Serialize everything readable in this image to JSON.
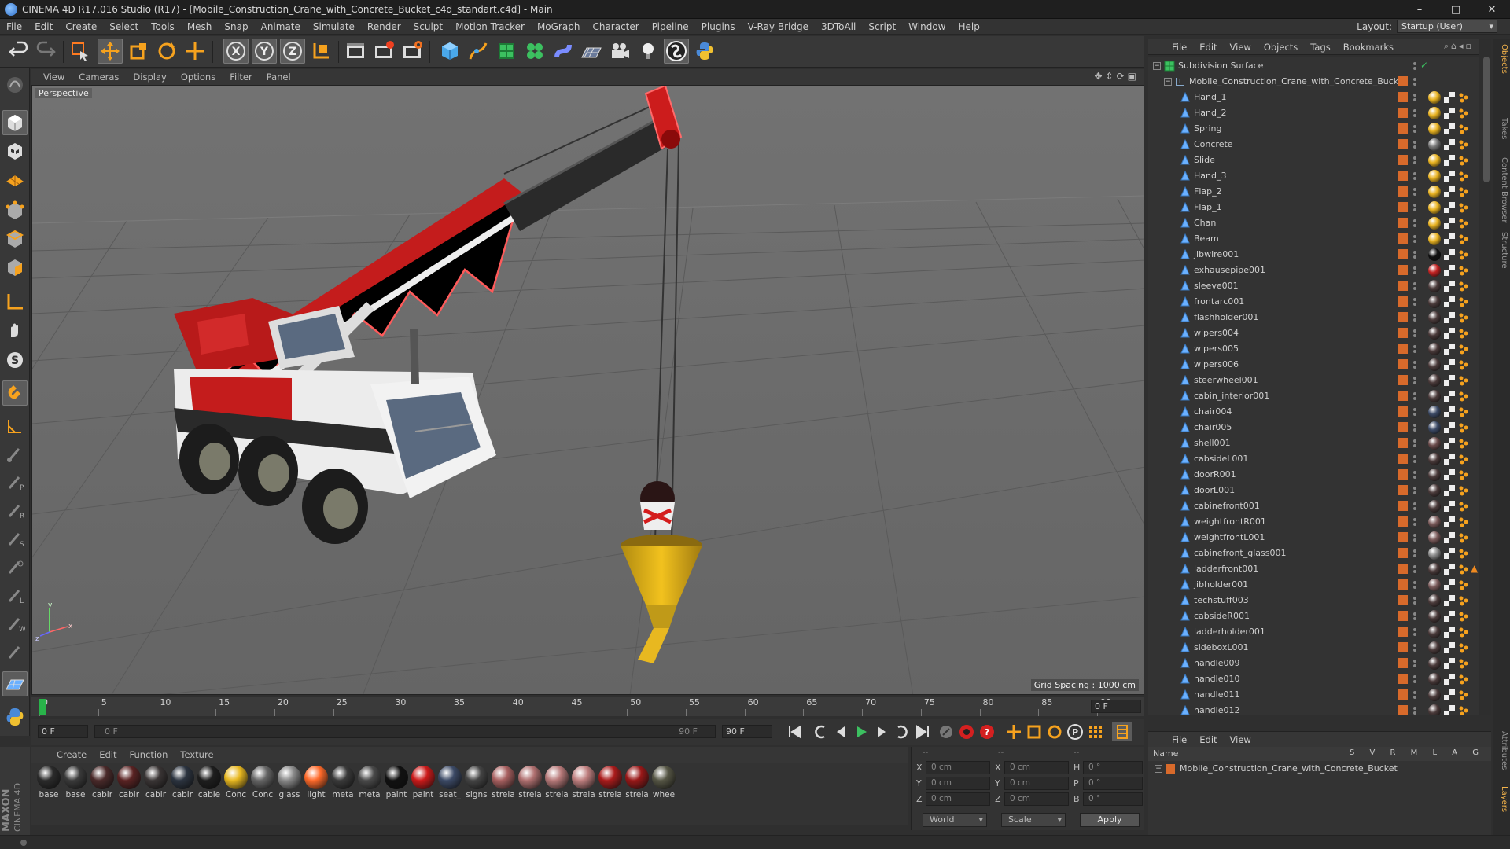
{
  "titlebar": {
    "title": "CINEMA 4D R17.016 Studio (R17) - [Mobile_Construction_Crane_with_Concrete_Bucket_c4d_standart.c4d] - Main",
    "minimize": "–",
    "maximize": "□",
    "close": "✕"
  },
  "menu": {
    "items": [
      "File",
      "Edit",
      "Create",
      "Select",
      "Tools",
      "Mesh",
      "Snap",
      "Animate",
      "Simulate",
      "Render",
      "Sculpt",
      "Motion Tracker",
      "MoGraph",
      "Character",
      "Pipeline",
      "Plugins",
      "V-Ray Bridge",
      "3DToAll",
      "Script",
      "Window",
      "Help"
    ],
    "layout_label": "Layout:",
    "layout_value": "Startup (User)"
  },
  "toolbar": {
    "icons": [
      "undo-icon",
      "redo-icon",
      "live-selection-icon",
      "move-icon",
      "scale-icon",
      "rotate-icon",
      "recent-tools-icon",
      "x-axis-icon",
      "y-axis-icon",
      "z-axis-icon",
      "coordinate-system-icon",
      "render-view-icon",
      "render-picture-viewer-icon",
      "edit-render-settings-icon",
      "cube-primitive-icon",
      "spline-pen-icon",
      "subdivision-icon",
      "cloner-icon",
      "deformer-icon",
      "floor-icon",
      "camera-icon",
      "light-icon",
      "vray-icon",
      "python-icon"
    ]
  },
  "viewport": {
    "menu": [
      "View",
      "Cameras",
      "Display",
      "Options",
      "Filter",
      "Panel"
    ],
    "label": "Perspective",
    "grid_spacing": "Grid Spacing : 1000 cm"
  },
  "timeline": {
    "ticks": [
      "0",
      "5",
      "10",
      "15",
      "20",
      "25",
      "30",
      "35",
      "40",
      "45",
      "50",
      "55",
      "60",
      "65",
      "70",
      "75",
      "80",
      "85",
      "90"
    ],
    "current_frame": "0 F"
  },
  "transport": {
    "start": "0 F",
    "range_start": "0 F",
    "range_end": "90 F",
    "end": "90 F"
  },
  "materials": {
    "menu": [
      "Create",
      "Edit",
      "Function",
      "Texture"
    ],
    "items": [
      {
        "name": "base",
        "color": "#2b2b2b"
      },
      {
        "name": "base",
        "color": "#3a3a3a"
      },
      {
        "name": "cabir",
        "color": "#4a2a2a"
      },
      {
        "name": "cabir",
        "color": "#5a2323"
      },
      {
        "name": "cabir",
        "color": "#3a3535"
      },
      {
        "name": "cabir",
        "color": "#2c3440"
      },
      {
        "name": "cable",
        "color": "#1e1e1e"
      },
      {
        "name": "Conc",
        "color": "#e8b820"
      },
      {
        "name": "Conc",
        "color": "#666666"
      },
      {
        "name": "glass",
        "color": "#8a8a8a"
      },
      {
        "name": "light",
        "color": "#ff6a2a"
      },
      {
        "name": "meta",
        "color": "#3a3a3a"
      },
      {
        "name": "meta",
        "color": "#4a4a4a"
      },
      {
        "name": "paint",
        "color": "#111111"
      },
      {
        "name": "paint",
        "color": "#cc1a1a"
      },
      {
        "name": "seat_",
        "color": "#3c4a66"
      },
      {
        "name": "signs",
        "color": "#444444"
      },
      {
        "name": "strela",
        "color": "#a86060"
      },
      {
        "name": "strela",
        "color": "#b07070"
      },
      {
        "name": "strela",
        "color": "#b87a7a"
      },
      {
        "name": "strela",
        "color": "#c08080"
      },
      {
        "name": "strela",
        "color": "#aa1b1b"
      },
      {
        "name": "strela",
        "color": "#991818"
      },
      {
        "name": "whee",
        "color": "#565645"
      }
    ]
  },
  "coords": {
    "x_label": "X",
    "y_label": "Y",
    "z_label": "Z",
    "h_label": "H",
    "p_label": "P",
    "b_label": "B",
    "pos_x": "0 cm",
    "pos_y": "0 cm",
    "pos_z": "0 cm",
    "size_x": "0 cm",
    "size_y": "0 cm",
    "size_z": "0 cm",
    "rot_h": "0 °",
    "rot_p": "0 °",
    "rot_b": "0 °",
    "header1": "--",
    "header2": "--",
    "header3": "--",
    "world": "World",
    "scale": "Scale",
    "apply": "Apply"
  },
  "objects": {
    "menu": [
      "File",
      "Edit",
      "View",
      "Objects",
      "Tags",
      "Bookmarks"
    ],
    "root": "Subdivision Surface",
    "group": "Mobile_Construction_Crane_with_Concrete_Bucket",
    "children": [
      {
        "name": "Hand_1",
        "tag": "#e9b321"
      },
      {
        "name": "Hand_2",
        "tag": "#e9b321"
      },
      {
        "name": "Spring",
        "tag": "#e9b321"
      },
      {
        "name": "Concrete",
        "tag": "#777777"
      },
      {
        "name": "Slide",
        "tag": "#e9b321"
      },
      {
        "name": "Hand_3",
        "tag": "#e9b321"
      },
      {
        "name": "Flap_2",
        "tag": "#e9b321"
      },
      {
        "name": "Flap_1",
        "tag": "#e9b321"
      },
      {
        "name": "Chan",
        "tag": "#e9b321"
      },
      {
        "name": "Beam",
        "tag": "#e9b321"
      },
      {
        "name": "jibwire001",
        "tag": "#111111"
      },
      {
        "name": "exhausepipe001",
        "tag": "#c22222"
      },
      {
        "name": "sleeve001",
        "tag": "#4a3a3a"
      },
      {
        "name": "frontarc001",
        "tag": "#4a3a3a"
      },
      {
        "name": "flashholder001",
        "tag": "#4a3a3a"
      },
      {
        "name": "wipers004",
        "tag": "#4a3a3a"
      },
      {
        "name": "wipers005",
        "tag": "#4a3a3a"
      },
      {
        "name": "wipers006",
        "tag": "#4a3a3a"
      },
      {
        "name": "steerwheel001",
        "tag": "#4a3a3a"
      },
      {
        "name": "cabin_interior001",
        "tag": "#4a3a3a"
      },
      {
        "name": "chair004",
        "tag": "#3c4a66"
      },
      {
        "name": "chair005",
        "tag": "#3c4a66"
      },
      {
        "name": "shell001",
        "tag": "#6a4a4a"
      },
      {
        "name": "cabsideL001",
        "tag": "#4a3a3a"
      },
      {
        "name": "doorR001",
        "tag": "#4a3a3a"
      },
      {
        "name": "doorL001",
        "tag": "#4a3a3a"
      },
      {
        "name": "cabinefront001",
        "tag": "#4a3a3a"
      },
      {
        "name": "weightfrontR001",
        "tag": "#7a5a5a"
      },
      {
        "name": "weightfrontL001",
        "tag": "#7a5a5a"
      },
      {
        "name": "cabinefront_glass001",
        "tag": "#8a8a8a"
      },
      {
        "name": "ladderfront001",
        "tag": "#4a3a3a"
      },
      {
        "name": "jibholder001",
        "tag": "#7a5a5a"
      },
      {
        "name": "techstuff003",
        "tag": "#4a3a3a"
      },
      {
        "name": "cabsideR001",
        "tag": "#4a3a3a"
      },
      {
        "name": "ladderholder001",
        "tag": "#4a3a3a"
      },
      {
        "name": "sideboxL001",
        "tag": "#4a3a3a"
      },
      {
        "name": "handle009",
        "tag": "#4a3a3a"
      },
      {
        "name": "handle010",
        "tag": "#4a3a3a"
      },
      {
        "name": "handle011",
        "tag": "#4a3a3a"
      },
      {
        "name": "handle012",
        "tag": "#4a3a3a"
      }
    ]
  },
  "right_tabs": [
    "Objects",
    "Takes",
    "Content Browser",
    "Structure",
    "Attributes",
    "Layers"
  ],
  "layers": {
    "menu": [
      "File",
      "Edit",
      "View"
    ],
    "name_header": "Name",
    "cols": "S V R M L A G",
    "row": "Mobile_Construction_Crane_with_Concrete_Bucket"
  },
  "maxon": {
    "brand1": "MAXON",
    "brand2": "CINEMA 4D"
  },
  "colors": {
    "accent": "#f2b24a",
    "layer_orange": "#d86a2b"
  }
}
